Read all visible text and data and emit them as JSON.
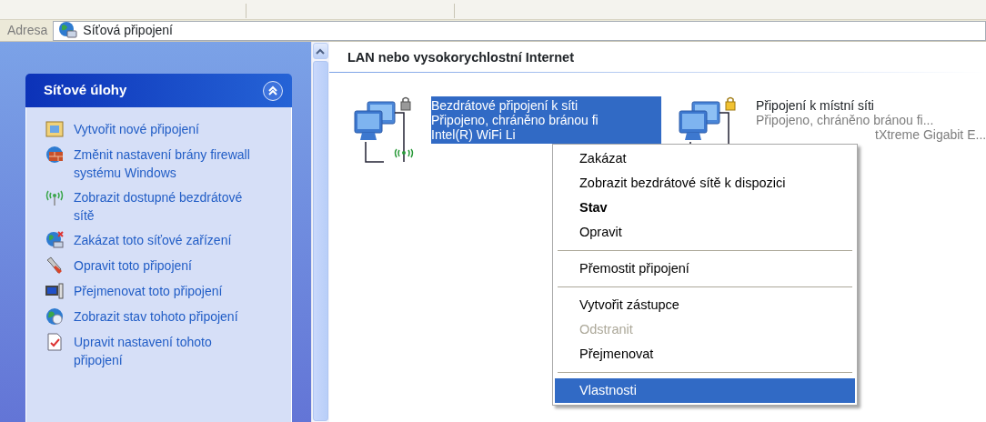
{
  "address_bar": {
    "label": "Adresa",
    "value": "Síťová připojení"
  },
  "task_pane": {
    "title": "Síťové úlohy",
    "expanded": true,
    "tasks": [
      {
        "label": "Vytvořit nové připojení"
      },
      {
        "label": "Změnit nastavení brány firewall systému Windows"
      },
      {
        "label": "Zobrazit dostupné bezdrátové sítě"
      },
      {
        "label": "Zakázat toto síťové zařízení"
      },
      {
        "label": "Opravit toto připojení"
      },
      {
        "label": "Přejmenovat toto připojení"
      },
      {
        "label": "Zobrazit stav tohoto připojení"
      },
      {
        "label": "Upravit nastavení tohoto připojení"
      }
    ]
  },
  "group": {
    "title": "LAN nebo vysokorychlostní Internet",
    "connections": [
      {
        "kind": "wireless",
        "selected": true,
        "name": "Bezdrátové připojení k síti",
        "status": "Připojeno, chráněno bránou fi",
        "device": "Intel(R) WiFi Li"
      },
      {
        "kind": "wired",
        "selected": false,
        "name": "Připojení k místní síti",
        "status": "Připojeno, chráněno bránou fi...",
        "device": "tXtreme Gigabit E..."
      }
    ]
  },
  "context_menu": [
    {
      "kind": "item",
      "label": "Zakázat",
      "default": false,
      "disabled": false,
      "selected": false
    },
    {
      "kind": "item",
      "label": "Zobrazit bezdrátové sítě k dispozici",
      "default": false,
      "disabled": false,
      "selected": false
    },
    {
      "kind": "item",
      "label": "Stav",
      "default": true,
      "disabled": false,
      "selected": false
    },
    {
      "kind": "item",
      "label": "Opravit",
      "default": false,
      "disabled": false,
      "selected": false
    },
    {
      "kind": "separator"
    },
    {
      "kind": "item",
      "label": "Přemostit připojení",
      "default": false,
      "disabled": false,
      "selected": false
    },
    {
      "kind": "separator"
    },
    {
      "kind": "item",
      "label": "Vytvořit zástupce",
      "default": false,
      "disabled": false,
      "selected": false
    },
    {
      "kind": "item",
      "label": "Odstranit",
      "default": false,
      "disabled": true,
      "selected": false
    },
    {
      "kind": "item",
      "label": "Přejmenovat",
      "default": false,
      "disabled": false,
      "selected": false
    },
    {
      "kind": "separator"
    },
    {
      "kind": "item",
      "label": "Vlastnosti",
      "default": false,
      "disabled": false,
      "selected": true
    }
  ]
}
